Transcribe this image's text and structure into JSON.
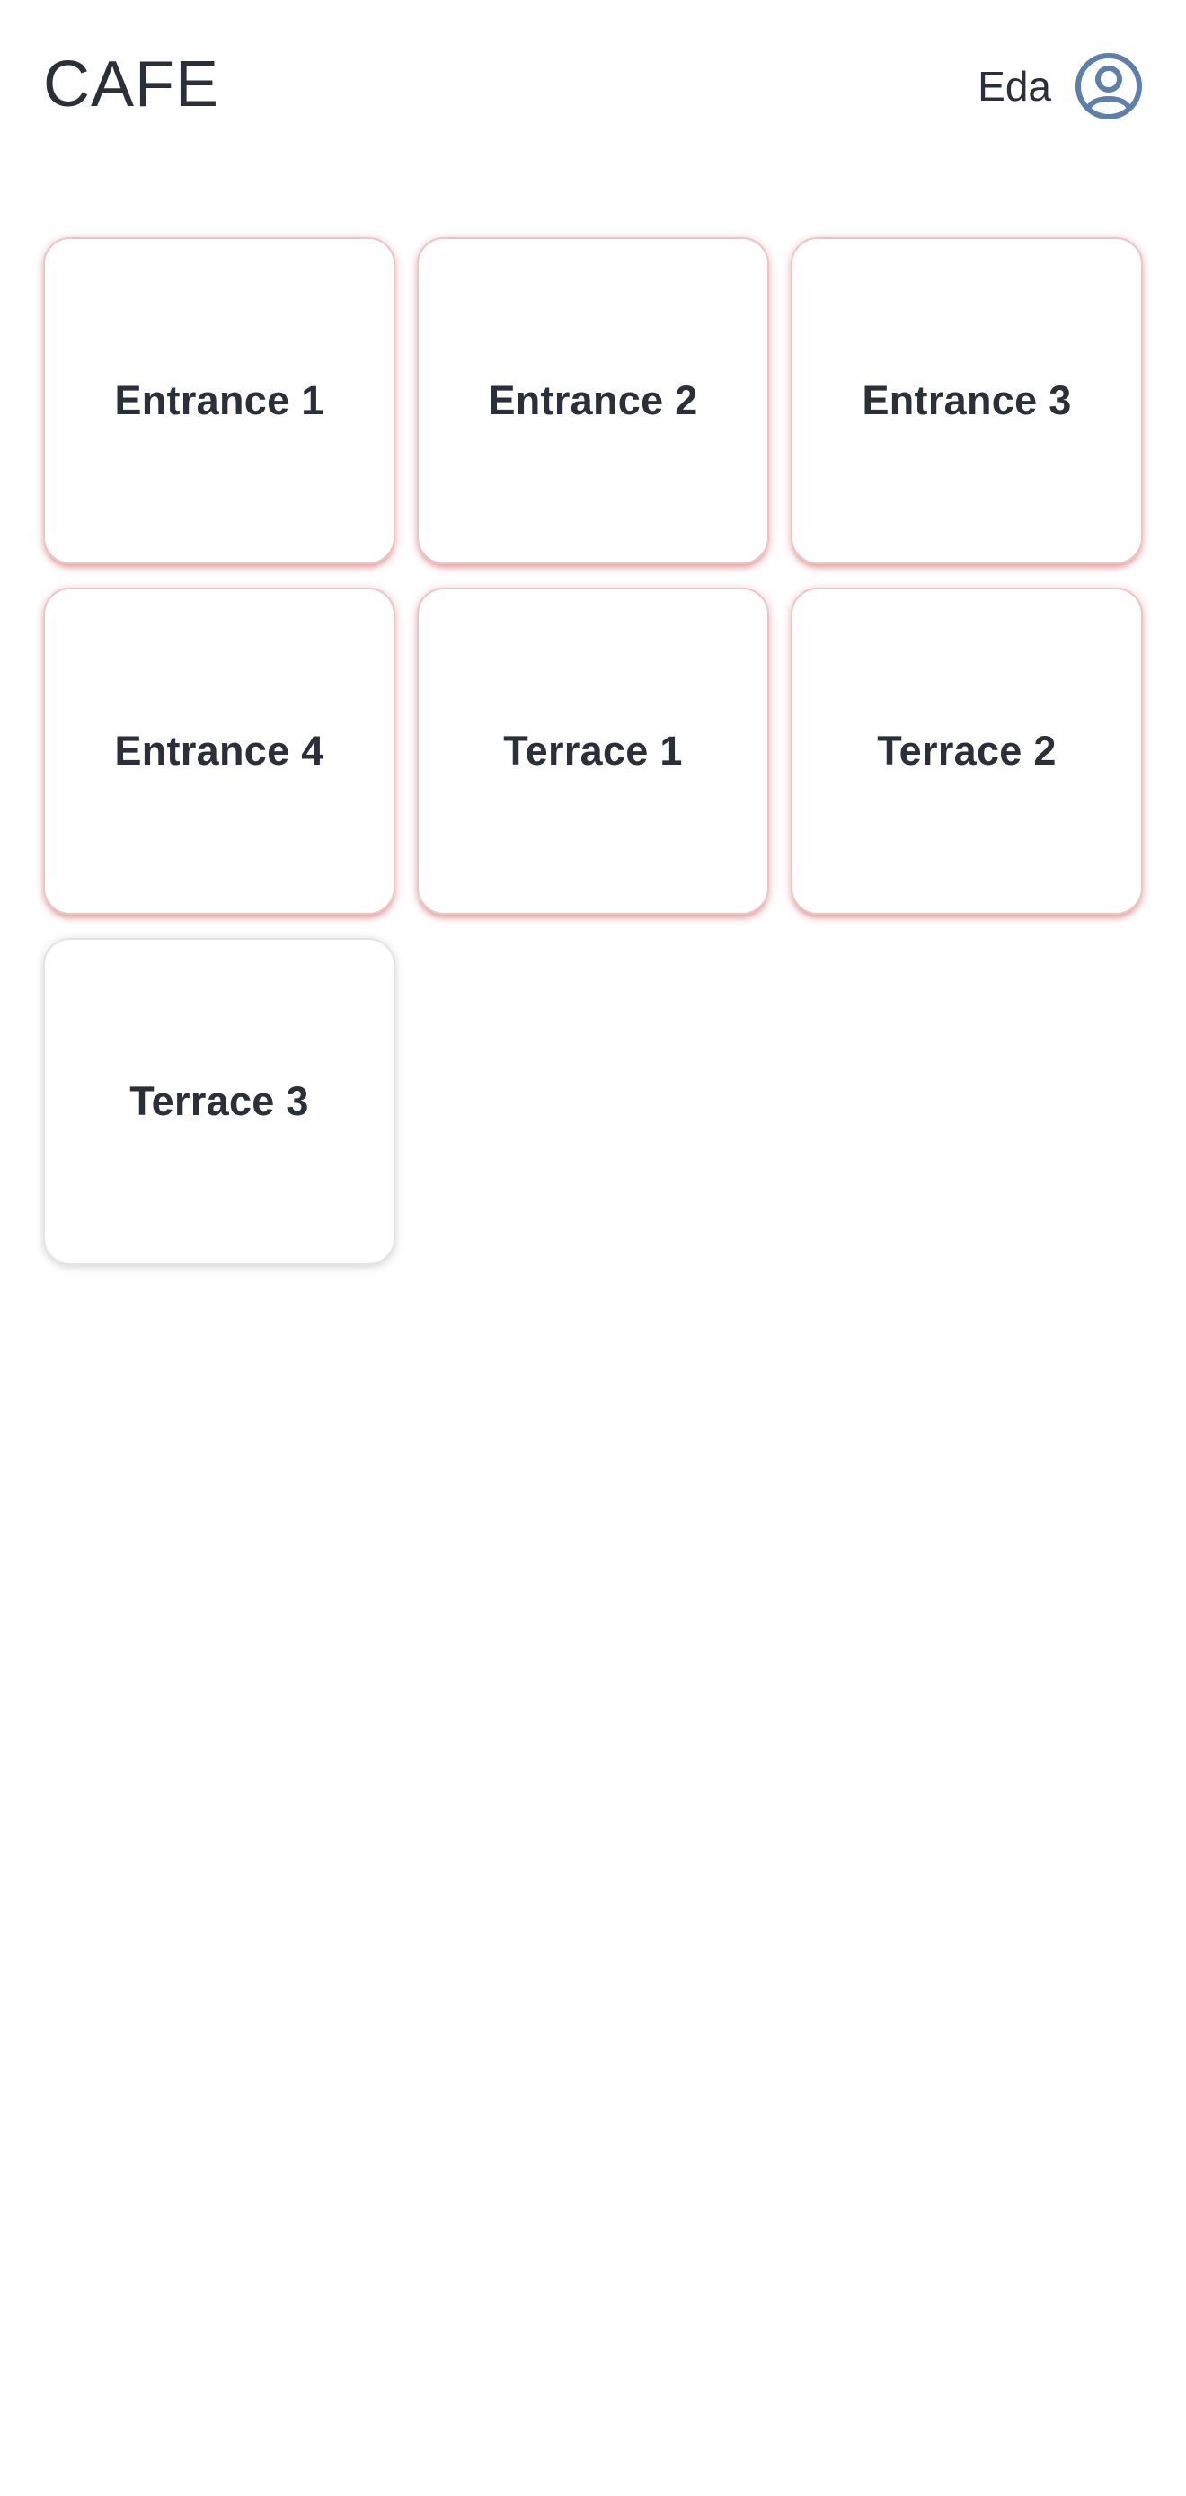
{
  "header": {
    "title": "CAFE",
    "user_name": "Eda",
    "user_icon": "user-circle-icon",
    "accent_color": "#5d7fac"
  },
  "tiles": [
    {
      "label": "Entrance 1",
      "state": "alert"
    },
    {
      "label": "Entrance 2",
      "state": "alert"
    },
    {
      "label": "Entrance 3",
      "state": "alert"
    },
    {
      "label": "Entrance 4",
      "state": "alert"
    },
    {
      "label": "Terrace 1",
      "state": "alert"
    },
    {
      "label": "Terrace 2",
      "state": "alert"
    },
    {
      "label": "Terrace 3",
      "state": "normal"
    }
  ],
  "colors": {
    "alert_border": "#ecc6c6",
    "text": "#2b2f3a",
    "background": "#ffffff"
  }
}
